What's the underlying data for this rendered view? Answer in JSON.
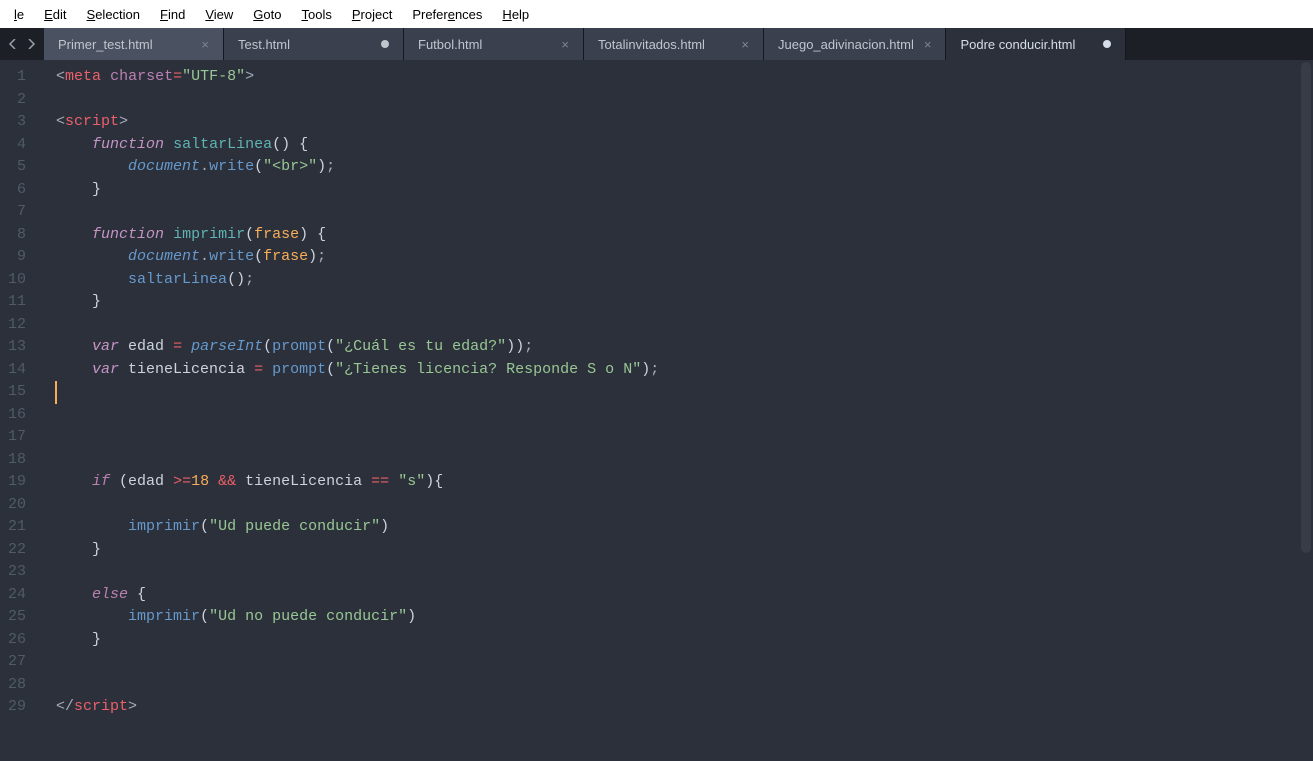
{
  "menu": {
    "items": [
      "le",
      "Edit",
      "Selection",
      "Find",
      "View",
      "Goto",
      "Tools",
      "Project",
      "Preferences",
      "Help"
    ],
    "underline_index": [
      0,
      0,
      0,
      0,
      0,
      0,
      0,
      0,
      6,
      0
    ]
  },
  "tabs": [
    {
      "name": "Primer_test.html",
      "state": "close",
      "active": false,
      "shade": "lighter"
    },
    {
      "name": "Test.html",
      "state": "dirty",
      "active": false,
      "shade": "inactive"
    },
    {
      "name": "Futbol.html",
      "state": "close",
      "active": false,
      "shade": "inactive"
    },
    {
      "name": "Totalinvitados.html",
      "state": "close",
      "active": false,
      "shade": "inactive"
    },
    {
      "name": "Juego_adivinacion.html",
      "state": "close",
      "active": false,
      "shade": "inactive"
    },
    {
      "name": "Podre conducir.html",
      "state": "dirty",
      "active": true,
      "shade": "active"
    }
  ],
  "editor": {
    "current_line": 15,
    "lines": [
      {
        "n": 1,
        "tokens": [
          [
            "<",
            "c-punct"
          ],
          [
            "meta",
            "c-tag"
          ],
          [
            " ",
            "c-plain"
          ],
          [
            "charset",
            "c-attr"
          ],
          [
            "=",
            "c-op"
          ],
          [
            "\"UTF-8\"",
            "c-string"
          ],
          [
            ">",
            "c-punct"
          ]
        ]
      },
      {
        "n": 2,
        "tokens": []
      },
      {
        "n": 3,
        "tokens": [
          [
            "<",
            "c-punct"
          ],
          [
            "script",
            "c-tag"
          ],
          [
            ">",
            "c-punct"
          ]
        ]
      },
      {
        "n": 4,
        "tokens": [
          [
            "    ",
            "c-plain"
          ],
          [
            "function",
            "c-stor"
          ],
          [
            " ",
            "c-plain"
          ],
          [
            "saltarLinea",
            "c-funcdef"
          ],
          [
            "(",
            "c-plain"
          ],
          [
            ")",
            "c-plain"
          ],
          [
            " {",
            "c-plain"
          ]
        ]
      },
      {
        "n": 5,
        "tokens": [
          [
            "        ",
            "c-plain"
          ],
          [
            "document",
            "c-obj"
          ],
          [
            ".",
            "c-punct"
          ],
          [
            "write",
            "c-func"
          ],
          [
            "(",
            "c-plain"
          ],
          [
            "\"<br>\"",
            "c-string"
          ],
          [
            ")",
            "c-plain"
          ],
          [
            ";",
            "c-punct"
          ]
        ]
      },
      {
        "n": 6,
        "tokens": [
          [
            "    }",
            "c-plain"
          ]
        ]
      },
      {
        "n": 7,
        "tokens": []
      },
      {
        "n": 8,
        "tokens": [
          [
            "    ",
            "c-plain"
          ],
          [
            "function",
            "c-stor"
          ],
          [
            " ",
            "c-plain"
          ],
          [
            "imprimir",
            "c-funcdef"
          ],
          [
            "(",
            "c-plain"
          ],
          [
            "frase",
            "c-param"
          ],
          [
            ")",
            "c-plain"
          ],
          [
            " {",
            "c-plain"
          ]
        ]
      },
      {
        "n": 9,
        "tokens": [
          [
            "        ",
            "c-plain"
          ],
          [
            "document",
            "c-obj"
          ],
          [
            ".",
            "c-punct"
          ],
          [
            "write",
            "c-func"
          ],
          [
            "(",
            "c-plain"
          ],
          [
            "frase",
            "c-param"
          ],
          [
            ")",
            "c-plain"
          ],
          [
            ";",
            "c-punct"
          ]
        ]
      },
      {
        "n": 10,
        "tokens": [
          [
            "        ",
            "c-plain"
          ],
          [
            "saltarLinea",
            "c-func"
          ],
          [
            "(",
            "c-plain"
          ],
          [
            ")",
            "c-plain"
          ],
          [
            ";",
            "c-punct"
          ]
        ]
      },
      {
        "n": 11,
        "tokens": [
          [
            "    }",
            "c-plain"
          ]
        ]
      },
      {
        "n": 12,
        "tokens": []
      },
      {
        "n": 13,
        "tokens": [
          [
            "    ",
            "c-plain"
          ],
          [
            "var",
            "c-stor"
          ],
          [
            " edad ",
            "c-plain"
          ],
          [
            "=",
            "c-op"
          ],
          [
            " ",
            "c-plain"
          ],
          [
            "parseInt",
            "c-obj"
          ],
          [
            "(",
            "c-plain"
          ],
          [
            "prompt",
            "c-func"
          ],
          [
            "(",
            "c-plain"
          ],
          [
            "\"¿Cuál es tu edad?\"",
            "c-string"
          ],
          [
            ")",
            "c-plain"
          ],
          [
            ")",
            "c-plain"
          ],
          [
            ";",
            "c-punct"
          ]
        ]
      },
      {
        "n": 14,
        "tokens": [
          [
            "    ",
            "c-plain"
          ],
          [
            "var",
            "c-stor"
          ],
          [
            " tieneLicencia ",
            "c-plain"
          ],
          [
            "=",
            "c-op"
          ],
          [
            " ",
            "c-plain"
          ],
          [
            "prompt",
            "c-func"
          ],
          [
            "(",
            "c-plain"
          ],
          [
            "\"¿Tienes licencia? Responde S o N\"",
            "c-string"
          ],
          [
            ")",
            "c-plain"
          ],
          [
            ";",
            "c-punct"
          ]
        ]
      },
      {
        "n": 15,
        "tokens": []
      },
      {
        "n": 16,
        "tokens": []
      },
      {
        "n": 17,
        "tokens": []
      },
      {
        "n": 18,
        "tokens": []
      },
      {
        "n": 19,
        "tokens": [
          [
            "    ",
            "c-plain"
          ],
          [
            "if",
            "c-keyword"
          ],
          [
            " (edad ",
            "c-plain"
          ],
          [
            ">=",
            "c-op"
          ],
          [
            "18",
            "c-num"
          ],
          [
            " ",
            "c-plain"
          ],
          [
            "&&",
            "c-op"
          ],
          [
            " tieneLicencia ",
            "c-plain"
          ],
          [
            "==",
            "c-op"
          ],
          [
            " ",
            "c-plain"
          ],
          [
            "\"s\"",
            "c-string"
          ],
          [
            "){",
            "c-plain"
          ]
        ]
      },
      {
        "n": 20,
        "tokens": []
      },
      {
        "n": 21,
        "tokens": [
          [
            "        ",
            "c-plain"
          ],
          [
            "imprimir",
            "c-func"
          ],
          [
            "(",
            "c-plain"
          ],
          [
            "\"Ud puede conducir\"",
            "c-string"
          ],
          [
            ")",
            "c-plain"
          ]
        ]
      },
      {
        "n": 22,
        "tokens": [
          [
            "    }",
            "c-plain"
          ]
        ]
      },
      {
        "n": 23,
        "tokens": []
      },
      {
        "n": 24,
        "tokens": [
          [
            "    ",
            "c-plain"
          ],
          [
            "else",
            "c-keyword"
          ],
          [
            " {",
            "c-plain"
          ]
        ]
      },
      {
        "n": 25,
        "tokens": [
          [
            "        ",
            "c-plain"
          ],
          [
            "imprimir",
            "c-func"
          ],
          [
            "(",
            "c-plain"
          ],
          [
            "\"Ud no puede conducir\"",
            "c-string"
          ],
          [
            ")",
            "c-plain"
          ]
        ]
      },
      {
        "n": 26,
        "tokens": [
          [
            "    }",
            "c-plain"
          ]
        ]
      },
      {
        "n": 27,
        "tokens": []
      },
      {
        "n": 28,
        "tokens": []
      },
      {
        "n": 29,
        "tokens": [
          [
            "</",
            "c-punct"
          ],
          [
            "script",
            "c-tag"
          ],
          [
            ">",
            "c-punct"
          ]
        ]
      }
    ]
  }
}
